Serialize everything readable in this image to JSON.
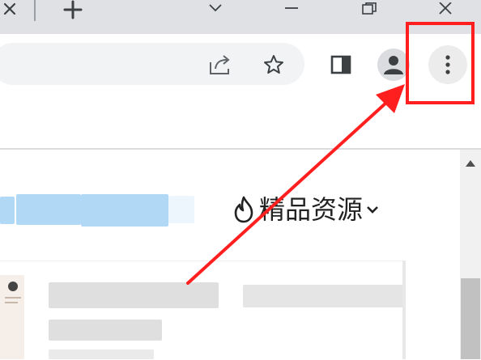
{
  "titlebar": {
    "close_tab_icon": "close-icon",
    "new_tab_icon": "plus-icon",
    "window_controls": [
      "minimize-icon",
      "restore-icon",
      "close-icon"
    ]
  },
  "toolbar": {
    "share_icon": "share-icon",
    "bookmark_icon": "star-icon",
    "side_panel_icon": "side-panel-icon",
    "profile_icon": "person-icon",
    "menu_icon": "three-dot-menu-icon"
  },
  "page": {
    "resource_menu_label": "精品资源",
    "resource_menu_icon": "flame-icon",
    "resource_menu_chevron": "chevron-down-icon"
  },
  "annotation": {
    "color": "#ff1f1f"
  }
}
